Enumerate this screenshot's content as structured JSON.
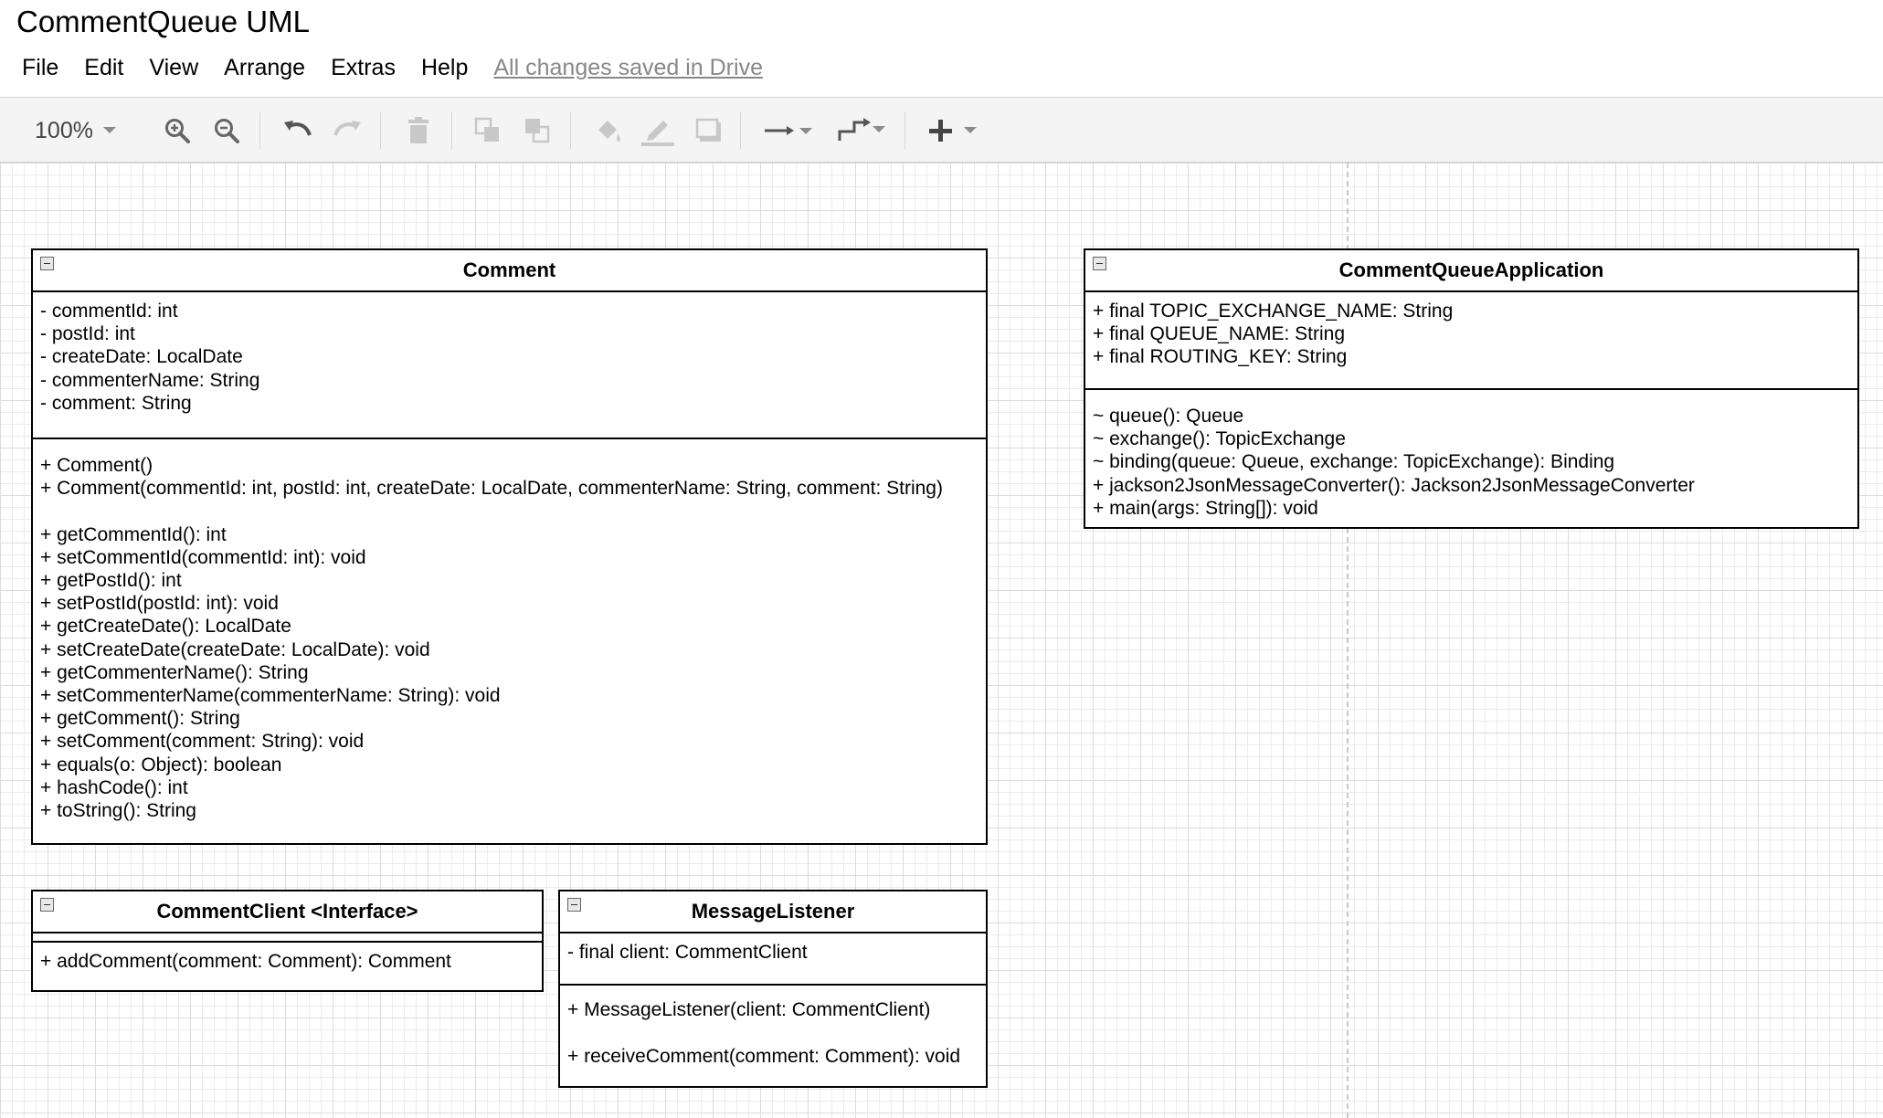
{
  "app": {
    "title": "CommentQueue UML",
    "save_status": "All changes saved in Drive"
  },
  "menu": [
    "File",
    "Edit",
    "View",
    "Arrange",
    "Extras",
    "Help"
  ],
  "toolbar": {
    "zoom": "100%",
    "icons": [
      "zoom-in-icon",
      "zoom-out-icon",
      "undo-icon",
      "redo-icon",
      "delete-icon",
      "to-front-icon",
      "to-back-icon",
      "fill-color-icon",
      "line-color-icon",
      "shadow-icon",
      "connection-icon",
      "waypoints-icon",
      "insert-icon"
    ]
  },
  "classes": {
    "comment": {
      "name": "Comment",
      "attributes": [
        "- commentId: int",
        "- postId: int",
        "- createDate: LocalDate",
        "- commenterName: String",
        "- comment: String"
      ],
      "methods": [
        "+ Comment()",
        "+ Comment(commentId: int, postId: int, createDate: LocalDate, commenterName: String, comment: String)",
        "",
        "+ getCommentId(): int",
        "+ setCommentId(commentId: int): void",
        "+ getPostId(): int",
        "+ setPostId(postId: int): void",
        "+ getCreateDate(): LocalDate",
        "+ setCreateDate(createDate: LocalDate): void",
        "+ getCommenterName(): String",
        "+ setCommenterName(commenterName: String): void",
        "+ getComment(): String",
        "+ setComment(comment: String): void",
        "+ equals(o: Object): boolean",
        "+ hashCode(): int",
        "+ toString(): String"
      ]
    },
    "comment_queue_application": {
      "name": "CommentQueueApplication",
      "attributes": [
        "+ final TOPIC_EXCHANGE_NAME: String",
        "+ final QUEUE_NAME: String",
        "+ final ROUTING_KEY: String"
      ],
      "methods": [
        "~ queue(): Queue",
        "~ exchange(): TopicExchange",
        "~ binding(queue: Queue, exchange: TopicExchange): Binding",
        "+ jackson2JsonMessageConverter(): Jackson2JsonMessageConverter",
        "+ main(args: String[]): void"
      ]
    },
    "comment_client": {
      "name": "CommentClient <Interface>",
      "attributes": [],
      "methods": [
        "+ addComment(comment: Comment): Comment"
      ]
    },
    "message_listener": {
      "name": "MessageListener",
      "attributes": [
        "- final client: CommentClient"
      ],
      "methods": [
        "+ MessageListener(client: CommentClient)",
        "",
        "+ receiveComment(comment: Comment): void"
      ]
    }
  }
}
